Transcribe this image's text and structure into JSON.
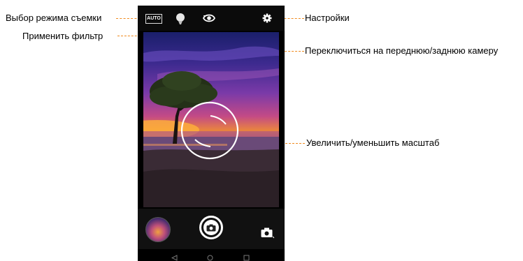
{
  "annotations": {
    "mode_select": "Выбор режима съемки",
    "apply_filter": "Применить фильтр",
    "switch_camera": "Переключиться на переднюю/заднюю камеру",
    "settings": "Настройки",
    "zoom": "Увеличить/уменьшить масштаб"
  },
  "camera": {
    "mode_label": "AUTO"
  },
  "colors": {
    "callout_line": "#f08a1e"
  },
  "icons": {
    "filter": "filter-icon",
    "switch": "switch-camera-icon",
    "settings": "gear-icon",
    "zoom": "zoom-ring-icon",
    "shutter": "camera-shutter-icon",
    "video_switch": "camera-mode-icon",
    "nav_back": "back-triangle-icon",
    "nav_home": "home-circle-icon",
    "nav_recent": "recent-square-icon"
  }
}
